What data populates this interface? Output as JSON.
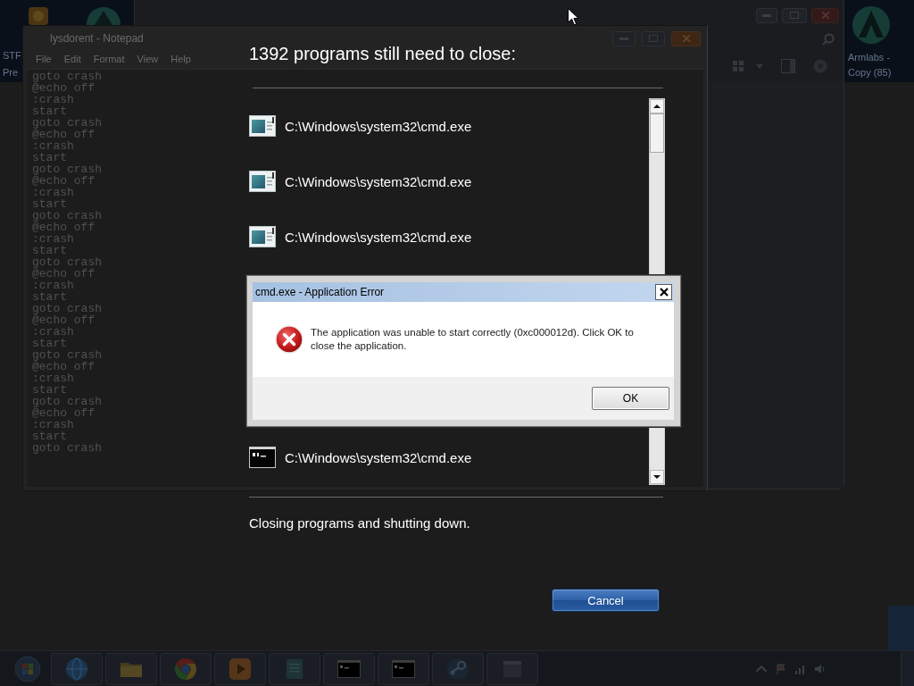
{
  "desktop": {
    "left_icon": {
      "label": "STF Pre"
    },
    "right_icon": {
      "label": "Armlabs - Copy (85)"
    }
  },
  "notepad": {
    "title": "lysdorent - Notepad",
    "menu": [
      "File",
      "Edit",
      "Format",
      "View",
      "Help"
    ],
    "lines": [
      "goto crash",
      "@echo off",
      ":crash",
      "start",
      "goto crash",
      "@echo off",
      ":crash",
      "start",
      "goto crash",
      "@echo off",
      ":crash",
      "start",
      "goto crash",
      "@echo off",
      ":crash",
      "start",
      "goto crash",
      "@echo off",
      ":crash",
      "start",
      "goto crash",
      "@echo off",
      ":crash",
      "start",
      "goto crash",
      "@echo off",
      ":crash",
      "start",
      "goto crash",
      "@echo off",
      ":crash",
      "start",
      "goto crash"
    ]
  },
  "shutdown": {
    "title": "1392 programs still need to close:",
    "programs": [
      {
        "kind": "window",
        "path": "C:\\Windows\\system32\\cmd.exe"
      },
      {
        "kind": "window",
        "path": "C:\\Windows\\system32\\cmd.exe"
      },
      {
        "kind": "window",
        "path": "C:\\Windows\\system32\\cmd.exe"
      },
      {
        "kind": "console",
        "path": "C:\\Windows\\system32\\cmd.exe"
      }
    ],
    "status": "Closing programs and shutting down.",
    "cancel_button": "Cancel"
  },
  "error_dialog": {
    "title": "cmd.exe - Application Error",
    "message": "The application was unable to start correctly (0xc000012d). Click OK to close the application.",
    "ok_button": "OK"
  }
}
